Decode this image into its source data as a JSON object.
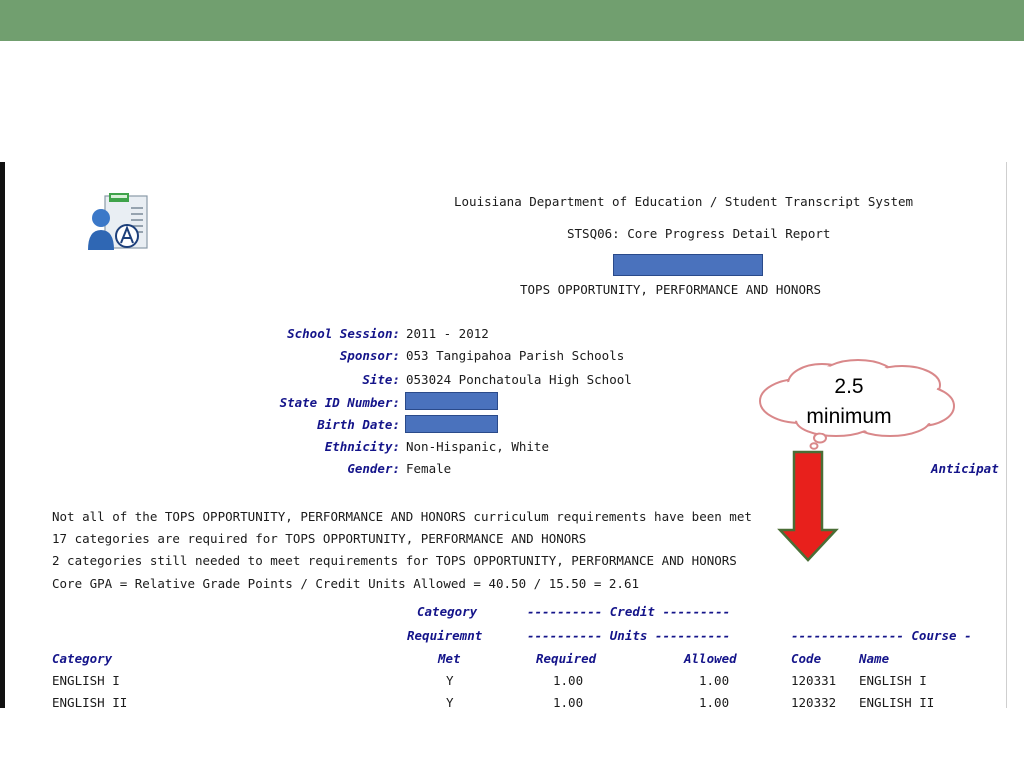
{
  "header": {
    "line1": "Louisiana Department of Education / Student Transcript System",
    "line2": "STSQ06: Core Progress Detail Report",
    "line3": "TOPS OPPORTUNITY, PERFORMANCE AND HONORS"
  },
  "student": {
    "school_session_label": "School Session:",
    "school_session_value": "2011 - 2012",
    "sponsor_label": "Sponsor:",
    "sponsor_value": "053    Tangipahoa Parish Schools",
    "site_label": "Site:",
    "site_value": "053024 Ponchatoula High School",
    "state_id_label": "State ID Number:",
    "birth_date_label": "Birth Date:",
    "ethnicity_label": "Ethnicity:",
    "ethnicity_value": "Non-Hispanic, White",
    "gender_label": "Gender:",
    "gender_value": "Female",
    "anticipated_label": "Anticipat"
  },
  "summary": {
    "line1": "Not all of the TOPS OPPORTUNITY, PERFORMANCE AND HONORS curriculum requirements have been met",
    "line2": " 17 categories are required for TOPS OPPORTUNITY, PERFORMANCE AND HONORS",
    "line3": "  2 categories still needed to meet requirements for TOPS OPPORTUNITY, PERFORMANCE AND HONORS",
    "gpa_line": "Core GPA = Relative Grade Points / Credit Units Allowed =           40.50 / 15.50 = 2.61"
  },
  "table": {
    "group_category": "Category",
    "group_credit": "---------- Credit ---------",
    "group_requirement": "Requiremnt",
    "group_units": "---------- Units ----------",
    "group_course": "--------------- Course -",
    "col_category": "Category",
    "col_met": "Met",
    "col_required": "Required",
    "col_allowed": "Allowed",
    "col_code": "Code",
    "col_name": "Name",
    "rows": [
      {
        "category": "ENGLISH I",
        "met": "Y",
        "required": "1.00",
        "allowed": "1.00",
        "code": "120331",
        "name": "ENGLISH I"
      },
      {
        "category": "ENGLISH II",
        "met": "Y",
        "required": "1.00",
        "allowed": "1.00",
        "code": "120332",
        "name": "ENGLISH II"
      }
    ]
  },
  "callout": {
    "line1": "2.5",
    "line2": "minimum",
    "arrow_color": "#e8201c",
    "cloud_border_color": "#d9888a"
  },
  "colors": {
    "top_bar": "#719f6f",
    "redaction": "#4a72bd",
    "label_blue": "#14148a"
  },
  "icons": {
    "report_icon": "student-report-icon"
  }
}
